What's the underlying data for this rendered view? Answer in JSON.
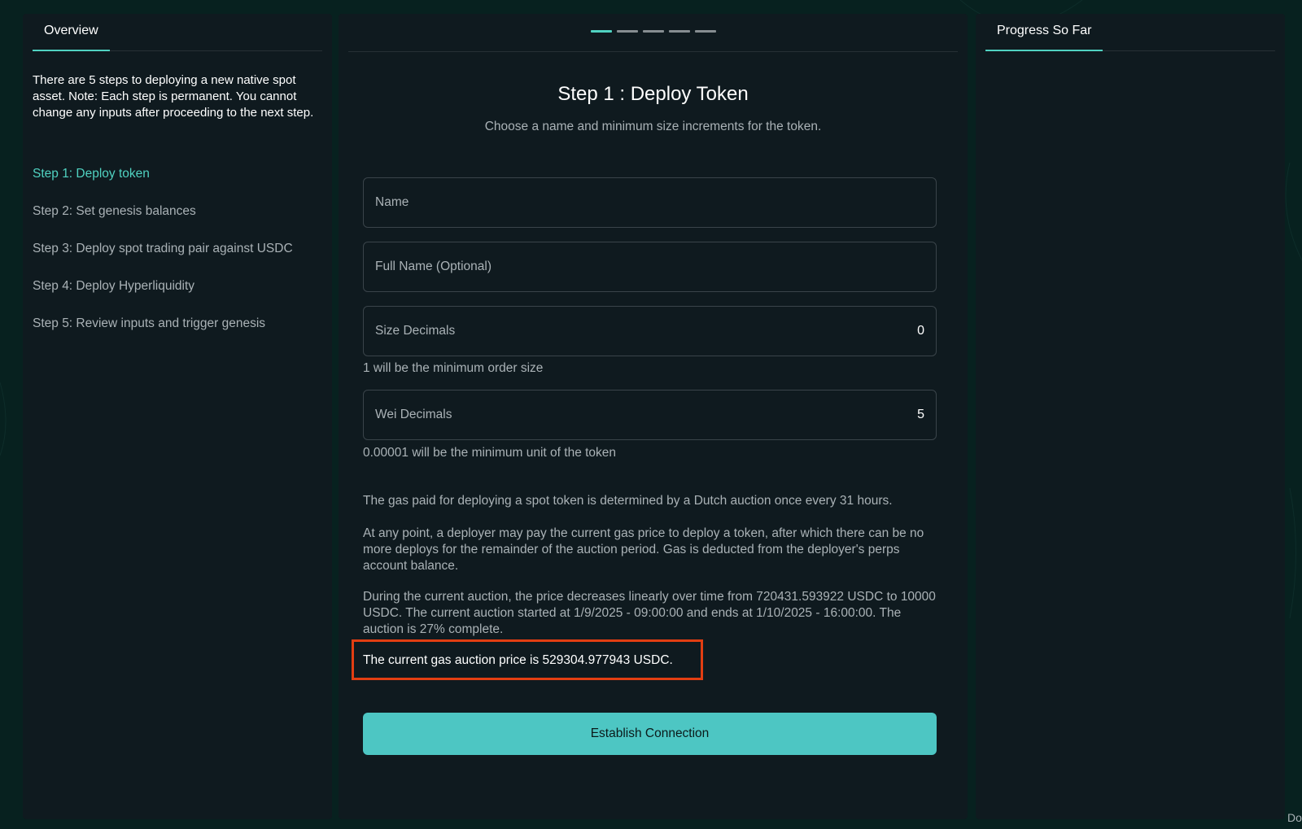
{
  "left_panel": {
    "tab_label": "Overview",
    "intro": "There are 5 steps to deploying a new native spot asset. Note: Each step is permanent. You cannot change any inputs after proceeding to the next step.",
    "steps": [
      {
        "label": "Step 1: Deploy token",
        "active": true
      },
      {
        "label": "Step 2: Set genesis balances",
        "active": false
      },
      {
        "label": "Step 3: Deploy spot trading pair against USDC",
        "active": false
      },
      {
        "label": "Step 4: Deploy Hyperliquidity",
        "active": false
      },
      {
        "label": "Step 5: Review inputs and trigger genesis",
        "active": false
      }
    ]
  },
  "center_panel": {
    "progress": {
      "total_steps": 5,
      "current_step": 1
    },
    "title": "Step 1 : Deploy Token",
    "subtitle": "Choose a name and minimum size increments for the token.",
    "fields": {
      "name": {
        "placeholder": "Name",
        "value": ""
      },
      "full_name": {
        "placeholder": "Full Name (Optional)",
        "value": ""
      },
      "size_decimals": {
        "label": "Size Decimals",
        "value": "0"
      },
      "wei_decimals": {
        "label": "Wei Decimals",
        "value": "5"
      }
    },
    "size_hint": "1 will be the minimum order size",
    "wei_hint": "0.00001 will be the minimum unit of the token",
    "paragraphs": [
      "The gas paid for deploying a spot token is determined by a Dutch auction once every 31 hours.",
      "At any point, a deployer may pay the current gas price to deploy a token, after which there can be no more deploys for the remainder of the auction period. Gas is deducted from the deployer's perps account balance.",
      "During the current auction, the price decreases linearly over time from 720431.593922 USDC to 10000 USDC. The current auction started at 1/9/2025 - 09:00:00 and ends at 1/10/2025 - 16:00:00. The auction is 27% complete."
    ],
    "gas_price_text": "The current gas auction price is 529304.977943 USDC.",
    "button_label": "Establish Connection"
  },
  "right_panel": {
    "tab_label": "Progress So Far"
  },
  "corner_text": "Do",
  "colors": {
    "accent": "#50d2c1",
    "button": "#4dc6c3",
    "highlight_border": "#e23e12",
    "panel_bg": "#0f1a1f",
    "page_bg": "#07211f"
  }
}
